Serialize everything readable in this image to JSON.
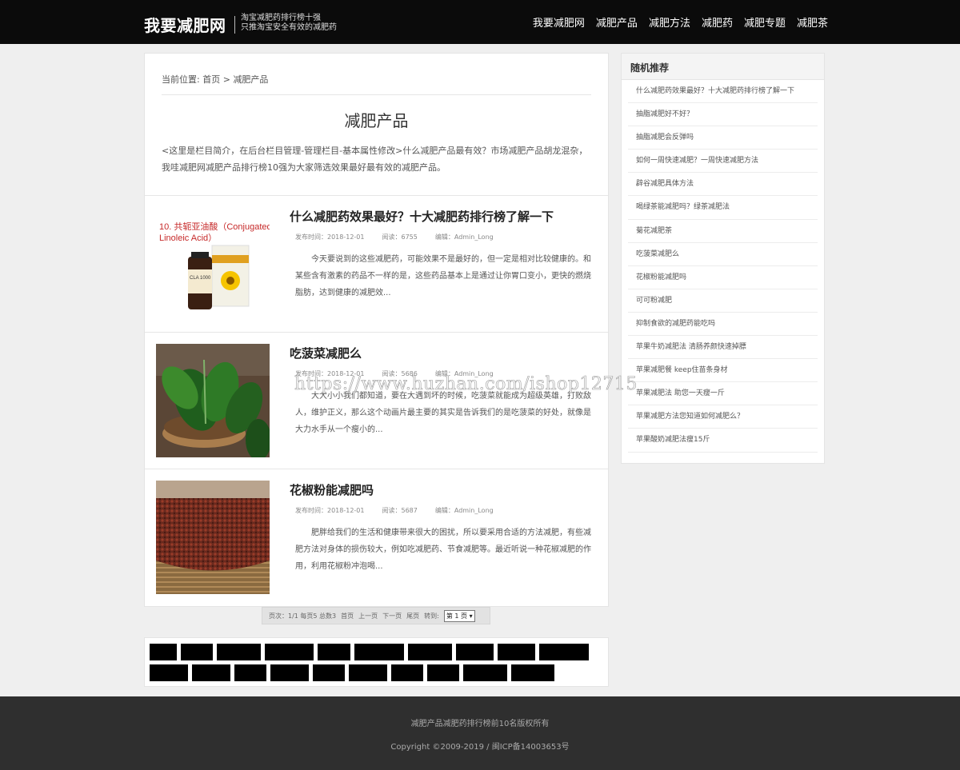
{
  "header": {
    "logo": "我要减肥网",
    "slogan_line1": "淘宝减肥药排行榜十强",
    "slogan_line2": "只推淘宝安全有效的减肥药",
    "nav": [
      "我要减肥网",
      "减肥产品",
      "减肥方法",
      "减肥药",
      "减肥专题",
      "减肥茶"
    ]
  },
  "breadcrumb": {
    "prefix": "当前位置:",
    "home": "首页",
    "sep": ">",
    "current": "减肥产品"
  },
  "category": {
    "title": "减肥产品",
    "description": "<这里是栏目简介，在后台栏目管理-管理栏目-基本属性修改>什么减肥产品最有效？市场减肥产品胡龙混杂，我哇减肥网减肥产品排行榜10强为大家筛选效果最好最有效的减肥产品。"
  },
  "articles": [
    {
      "title": "什么减肥药效果最好？十大减肥药排行榜了解一下",
      "date": "发布时间：2018-12-01",
      "views": "阅读：6755",
      "editor": "编辑：Admin_Long",
      "summary": "今天要说到的这些减肥药，可能效果不是最好的，但一定是相对比较健康的。和某些含有激素的药品不一样的是，这些药品基本上是通过让你胃口变小，更快的燃烧脂肪，达到健康的减肥效...",
      "thumb_caption": "10. 共轭亚油酸（Conjugated Linoleic Acid）",
      "thumb_label": "CLA 1000"
    },
    {
      "title": "吃菠菜减肥么",
      "date": "发布时间：2018-12-01",
      "views": "阅读：5686",
      "editor": "编辑：Admin_Long",
      "summary": "大大小小我们都知道，要在大遇到坏的时候，吃菠菜就能成为超级英雄，打败敌人，维护正义，那么这个动画片最主要的其实是告诉我们的是吃菠菜的好处，就像是大力水手从一个瘦小的..."
    },
    {
      "title": "花椒粉能减肥吗",
      "date": "发布时间：2018-12-01",
      "views": "阅读：5687",
      "editor": "编辑：Admin_Long",
      "summary": "肥胖给我们的生活和健康带来很大的困扰，所以要采用合适的方法减肥，有些减肥方法对身体的损伤较大，例如吃减肥药、节食减肥等。最近听说一种花椒减肥的作用，利用花椒粉冲泡喝..."
    }
  ],
  "pager": {
    "info": "页次：1/1 每页5 总数3",
    "first": "首页",
    "prev": "上一页",
    "next": "下一页",
    "last": "尾页",
    "goto": "转到:",
    "selected": "第 1 页"
  },
  "sidebar": {
    "title": "随机推荐",
    "items": [
      "什么减肥药效果最好？十大减肥药排行榜了解一下",
      "抽脂减肥好不好？",
      "抽脂减肥会反弹吗",
      "如何一周快速减肥？一周快速减肥方法",
      "辟谷减肥具体方法",
      "喝绿茶能减肥吗？绿茶减肥法",
      "菊花减肥茶",
      "吃菠菜减肥么",
      "花椒粉能减肥吗",
      "可可粉减肥",
      "抑制食欲的减肥药能吃吗",
      "苹果牛奶减肥法 清肠养颜快速掉膘",
      "苹果减肥餐 keep住苗条身材",
      "苹果减肥法 助您一天瘦一斤",
      "苹果减肥方法您知道如何减肥么？",
      "苹果酸奶减肥法瘦15斤"
    ]
  },
  "footer": {
    "line1": "减肥产品减肥药排行榜前10名版权所有",
    "line2": "Copyright ©2009-2019 / 闽ICP备14003653号"
  },
  "watermark": "https://www.huzhan.com/ishop12715",
  "colors": {
    "topbar": "#0b0b0b",
    "footer": "#2f2f2f",
    "page_bg": "#efefef"
  }
}
